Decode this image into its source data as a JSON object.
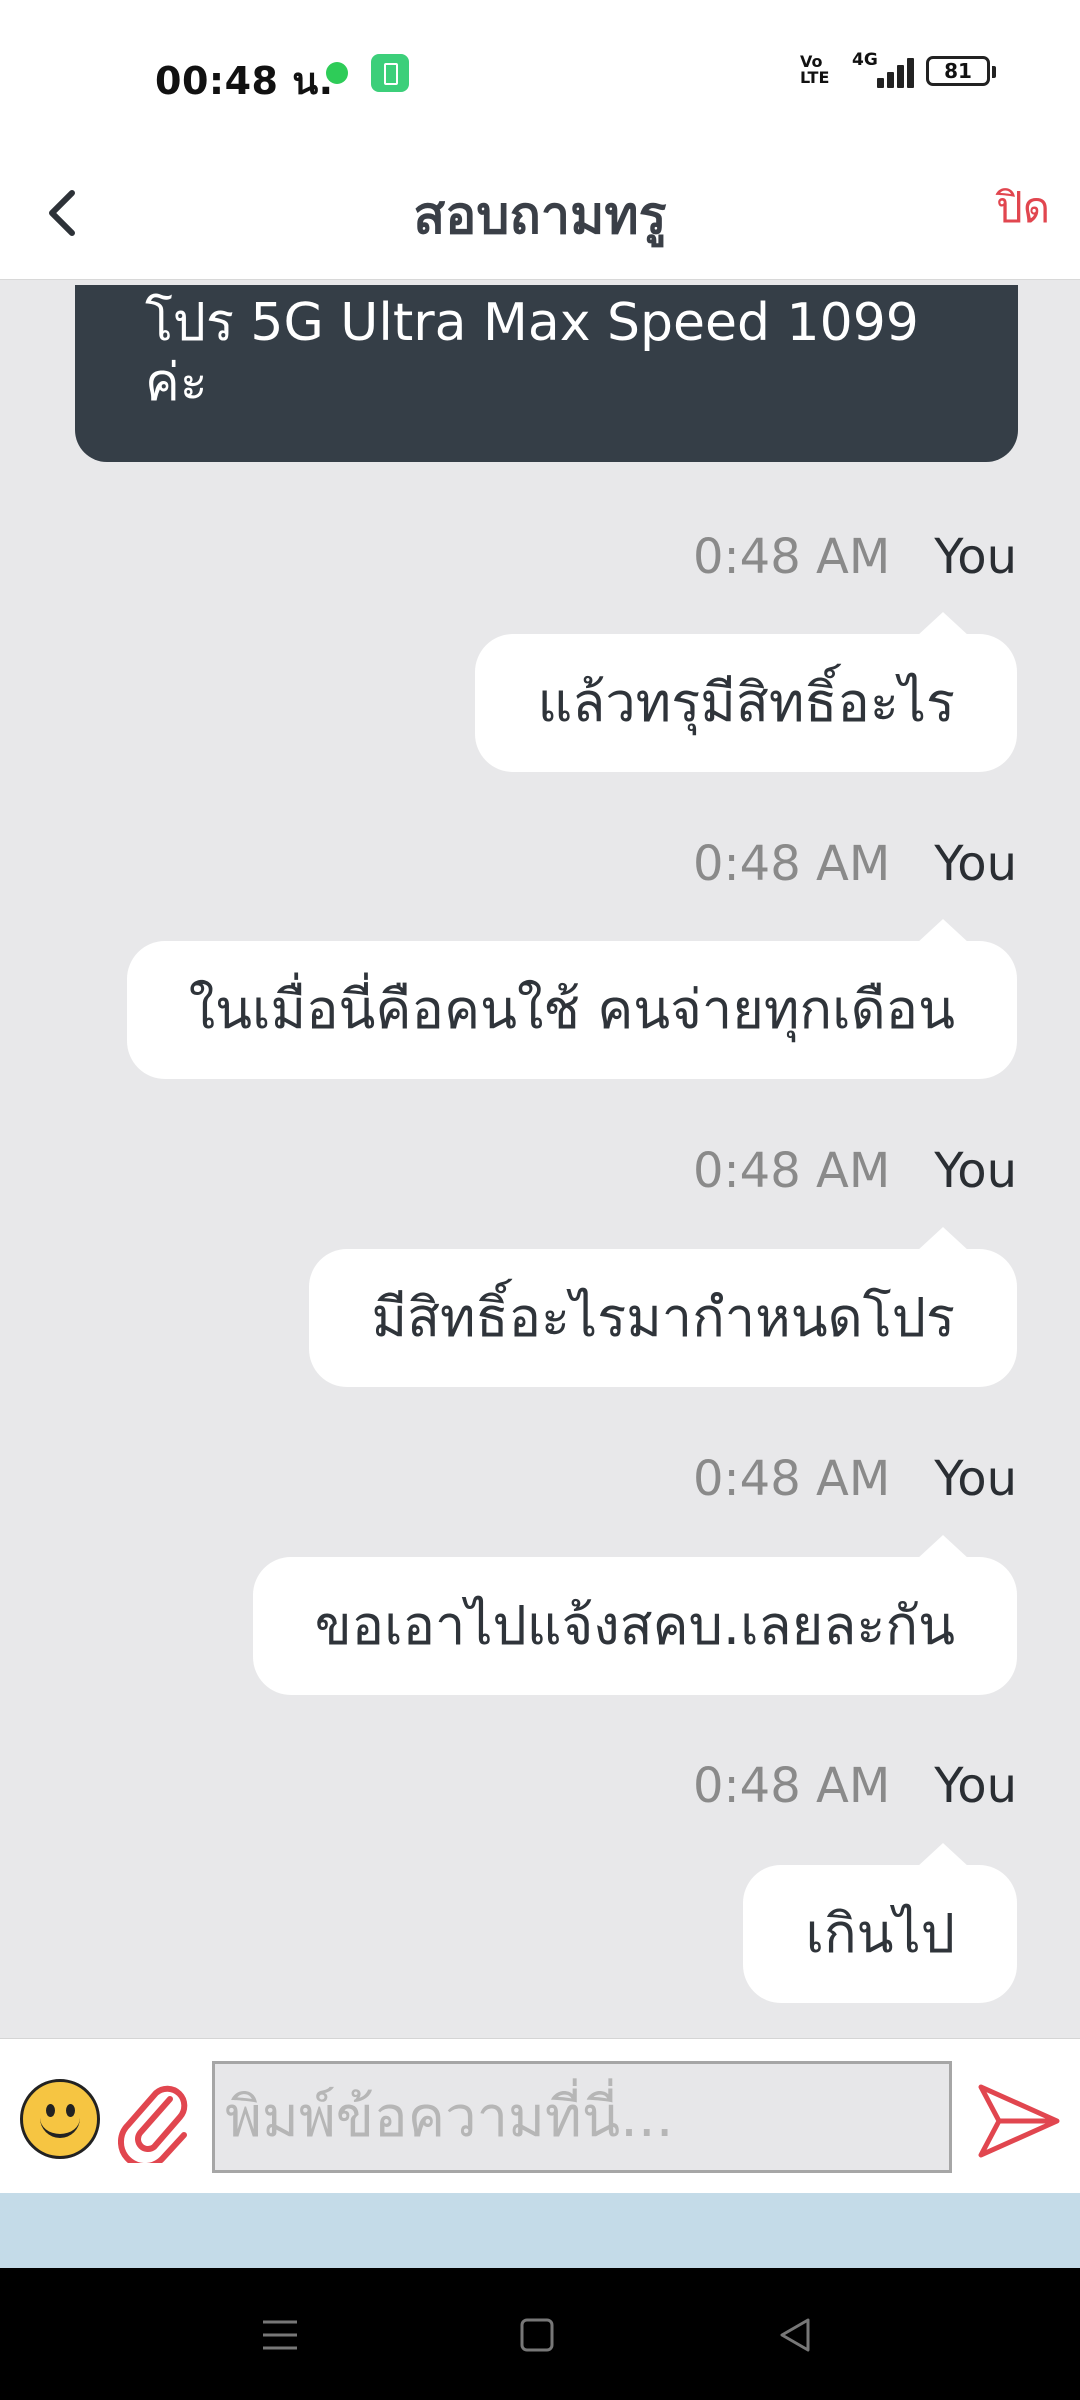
{
  "status_bar": {
    "time": "00:48 น.",
    "volte": "Vo LTE",
    "network": "4G",
    "battery": "81"
  },
  "header": {
    "title": "สอบถามทรู",
    "close_label": "ปิด",
    "back_icon": "chevron-left-icon"
  },
  "agent_message": {
    "text": "โปร 5G Ultra Max Speed 1099 ค่ะ"
  },
  "messages": [
    {
      "time": "0:48 AM",
      "sender": "You",
      "text": "แล้วทรุมีสิทธิ์อะไร"
    },
    {
      "time": "0:48 AM",
      "sender": "You",
      "text": "ในเมื่อนี่คือคนใช้ คนจ่ายทุกเดือน"
    },
    {
      "time": "0:48 AM",
      "sender": "You",
      "text": "มีสิทธิ์อะไรมากำหนดโปร"
    },
    {
      "time": "0:48 AM",
      "sender": "You",
      "text": "ขอเอาไปแจ้งสคบ.เลยละกัน"
    },
    {
      "time": "0:48 AM",
      "sender": "You",
      "text": "เกินไป"
    }
  ],
  "composer": {
    "placeholder": "พิมพ์ข้อความที่นี่...",
    "value": "",
    "emoji_icon": "smiley-icon",
    "attach_icon": "paperclip-icon",
    "send_icon": "send-icon"
  },
  "colors": {
    "accent": "#e1464f",
    "agent_bubble": "#353e47",
    "chat_background": "#e8e8ea"
  }
}
